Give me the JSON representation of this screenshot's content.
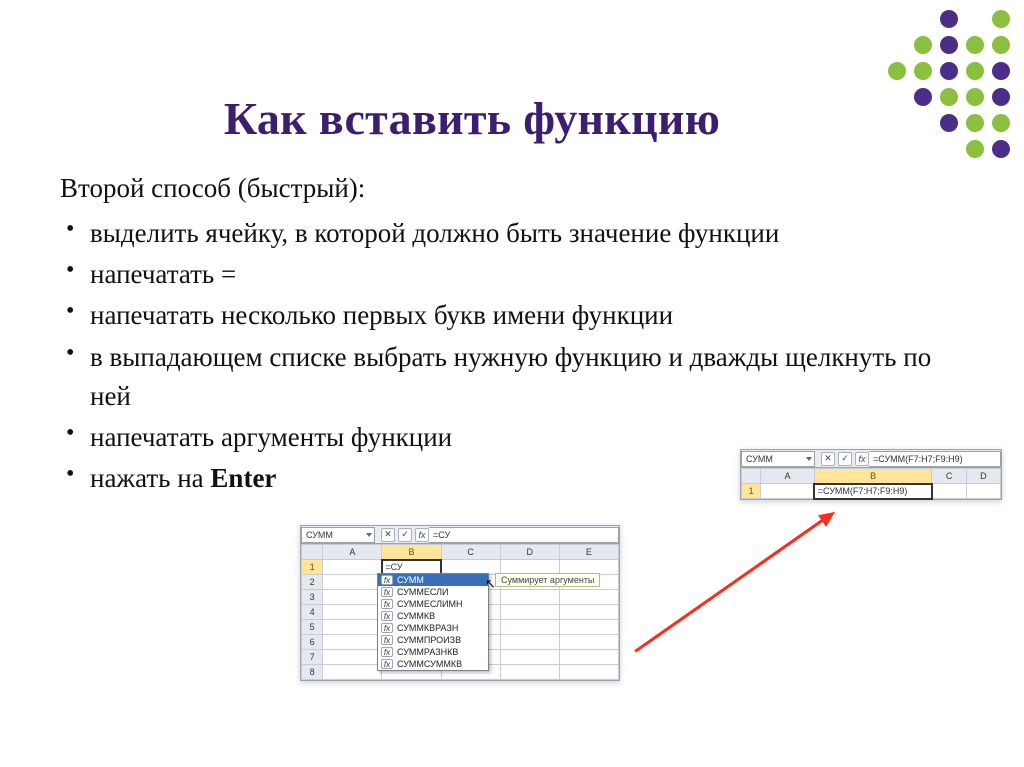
{
  "title": "Как вставить функцию",
  "intro": "Второй способ (быстрый):",
  "bullets": [
    "выделить ячейку, в которой должно быть значение функции",
    "напечатать =",
    "напечатать несколько первых букв имени функции",
    "в выпадающем списке выбрать нужную функцию и дважды щелкнуть по ней",
    "напечатать аргументы функции"
  ],
  "last_bullet_pre": "нажать на ",
  "last_bullet_strong": "Enter",
  "excel1": {
    "namebox": "СУММ",
    "formula": "=СУ",
    "cell_edit": "=СУ",
    "cols": [
      "A",
      "B",
      "C",
      "D",
      "E"
    ],
    "rows": [
      "1",
      "2",
      "3",
      "4",
      "5",
      "6",
      "7",
      "8"
    ],
    "tooltip": "Суммирует аргументы"
  },
  "autocomplete": [
    "СУММ",
    "СУММЕСЛИ",
    "СУММЕСЛИМН",
    "СУММКВ",
    "СУММКВРАЗН",
    "СУММПРОИЗВ",
    "СУММРАЗНКВ",
    "СУММСУММКВ"
  ],
  "excel2": {
    "namebox": "СУММ",
    "formula": "=СУММ(F7:H7;F9:H9)",
    "cell_edit": "=СУММ(F7:H7;F9:H9)",
    "cols": [
      "A",
      "B",
      "C",
      "D"
    ],
    "row": "1"
  },
  "fx_label": "fx"
}
